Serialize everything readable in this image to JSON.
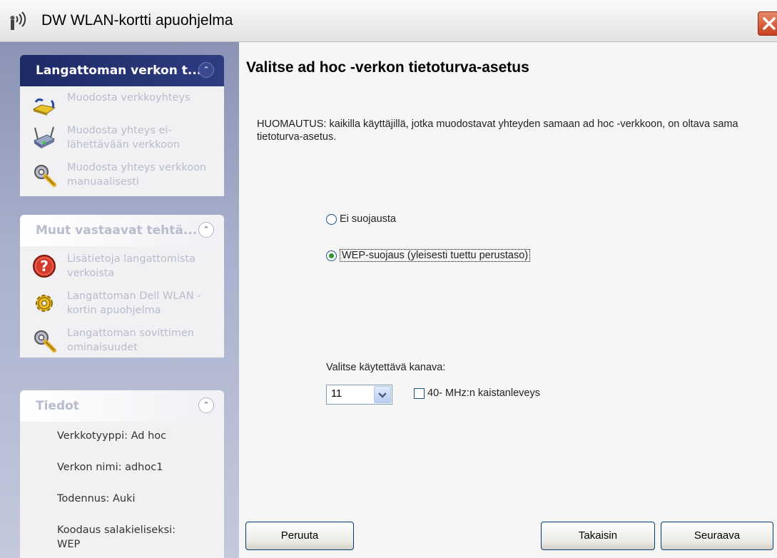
{
  "window": {
    "title": "DW WLAN-kortti apuohjelma"
  },
  "sidebar": {
    "panels": [
      {
        "title": "Langattoman verkon t...",
        "tasks": [
          {
            "label": "Muodosta verkkoyhteys",
            "icon": "network-cable-icon"
          },
          {
            "label": "Muodosta yhteys ei-lähettävään verkkoon",
            "icon": "router-icon"
          },
          {
            "label": "Muodosta yhteys verkkoon manuaalisesti",
            "icon": "gear-wrench-icon"
          }
        ]
      },
      {
        "title": "Muut vastaavat tehtä...",
        "tasks": [
          {
            "label": "Lisätietoja langattomista verkoista",
            "icon": "help-icon"
          },
          {
            "label": "Langattoman Dell WLAN -kortin apuohjelma",
            "icon": "gear-icon"
          },
          {
            "label": "Langattoman sovittimen ominaisuudet",
            "icon": "gear-wrench-icon"
          }
        ]
      },
      {
        "title": "Tiedot",
        "info": [
          "Verkkotyyppi: Ad hoc",
          "Verkon nimi: adhoc1",
          "Todennus: Auki",
          "Koodaus salakieliseksi: WEP"
        ]
      }
    ]
  },
  "main": {
    "title": "Valitse ad hoc -verkon tietoturva-asetus",
    "note": "HUOMAUTUS: kaikilla käyttäjillä, jotka muodostavat yhteyden samaan ad hoc -verkkoon, on oltava sama tietoturva-asetus.",
    "security_options": [
      {
        "label": "Ei suojausta",
        "selected": false
      },
      {
        "label": "WEP-suojaus (yleisesti tuettu perustaso)",
        "selected": true
      }
    ],
    "channel_label": "Valitse käytettävä kanava:",
    "channel_value": "11",
    "bandwidth_label": "40- MHz:n kaistanleveys",
    "bandwidth_checked": false
  },
  "buttons": {
    "cancel": "Peruuta",
    "back": "Takaisin",
    "next": "Seuraava"
  },
  "colors": {
    "sidebar_dark_header": "#1e2a66",
    "close_button": "#c9401f",
    "radio_dot": "#2a9c2a"
  }
}
